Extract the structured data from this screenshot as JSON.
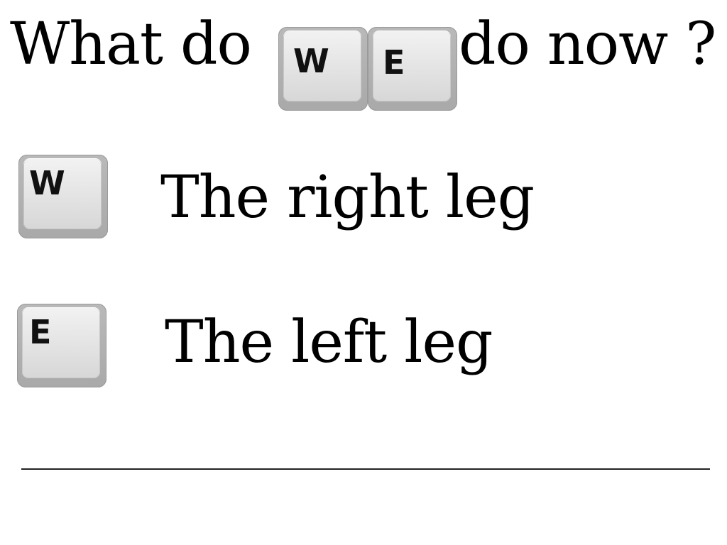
{
  "question": {
    "prefix": "What do",
    "suffix": "do now ?",
    "keys": [
      "W",
      "E"
    ]
  },
  "options": [
    {
      "key": "W",
      "label": "The right leg"
    },
    {
      "key": "E",
      "label": "The left leg"
    }
  ]
}
